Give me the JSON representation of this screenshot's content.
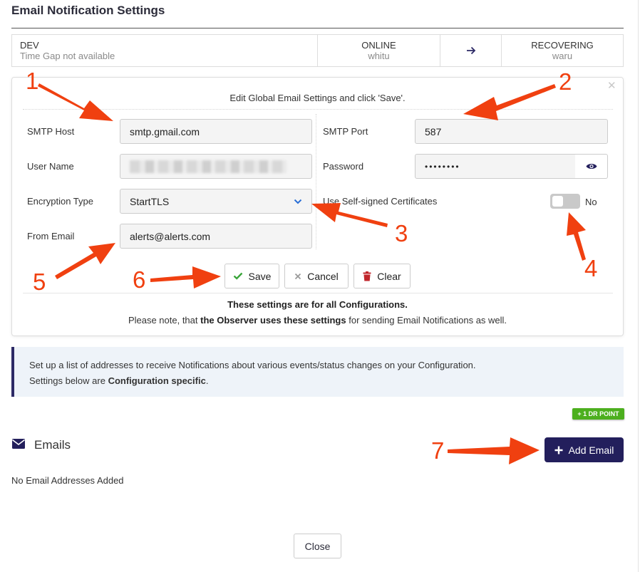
{
  "page": {
    "title": "Email Notification Settings"
  },
  "status": {
    "site": "DEV",
    "time_gap": "Time Gap not available",
    "primary_state": "ONLINE",
    "primary_name": "whitu",
    "secondary_state": "RECOVERING",
    "secondary_name": "waru"
  },
  "panel": {
    "heading": "Edit Global Email Settings and click 'Save'.",
    "smtp_host_label": "SMTP Host",
    "smtp_host_value": "smtp.gmail.com",
    "user_name_label": "User Name",
    "encryption_label": "Encryption Type",
    "encryption_value": "StartTLS",
    "from_email_label": "From Email",
    "from_email_value": "alerts@alerts.com",
    "smtp_port_label": "SMTP Port",
    "smtp_port_value": "587",
    "password_label": "Password",
    "password_value": "••••••••",
    "self_signed_label": "Use Self-signed Certificates",
    "self_signed_state": "No",
    "save_label": "Save",
    "cancel_label": "Cancel",
    "clear_label": "Clear",
    "note_bold": "These settings are for all Configurations.",
    "note_pre": "Please note, that ",
    "note_emph": "the Observer uses these settings",
    "note_post": " for sending Email Notifications as well."
  },
  "info": {
    "line1": "Set up a list of addresses to receive Notifications about various events/status changes on your Configuration.",
    "line2_pre": "Settings below are ",
    "line2_bold": "Configuration specific",
    "line2_post": "."
  },
  "badge": "+ 1 DR POINT",
  "emails": {
    "title": "Emails",
    "add_label": "Add Email",
    "empty_text": "No Email Addresses Added"
  },
  "footer": {
    "close_label": "Close"
  },
  "annotations": [
    "1",
    "2",
    "3",
    "4",
    "5",
    "6",
    "7"
  ],
  "colors": {
    "accent": "#231f5c",
    "annotation": "#f04010",
    "badge": "#4caf1e",
    "link_icon": "#2a6fd6"
  }
}
